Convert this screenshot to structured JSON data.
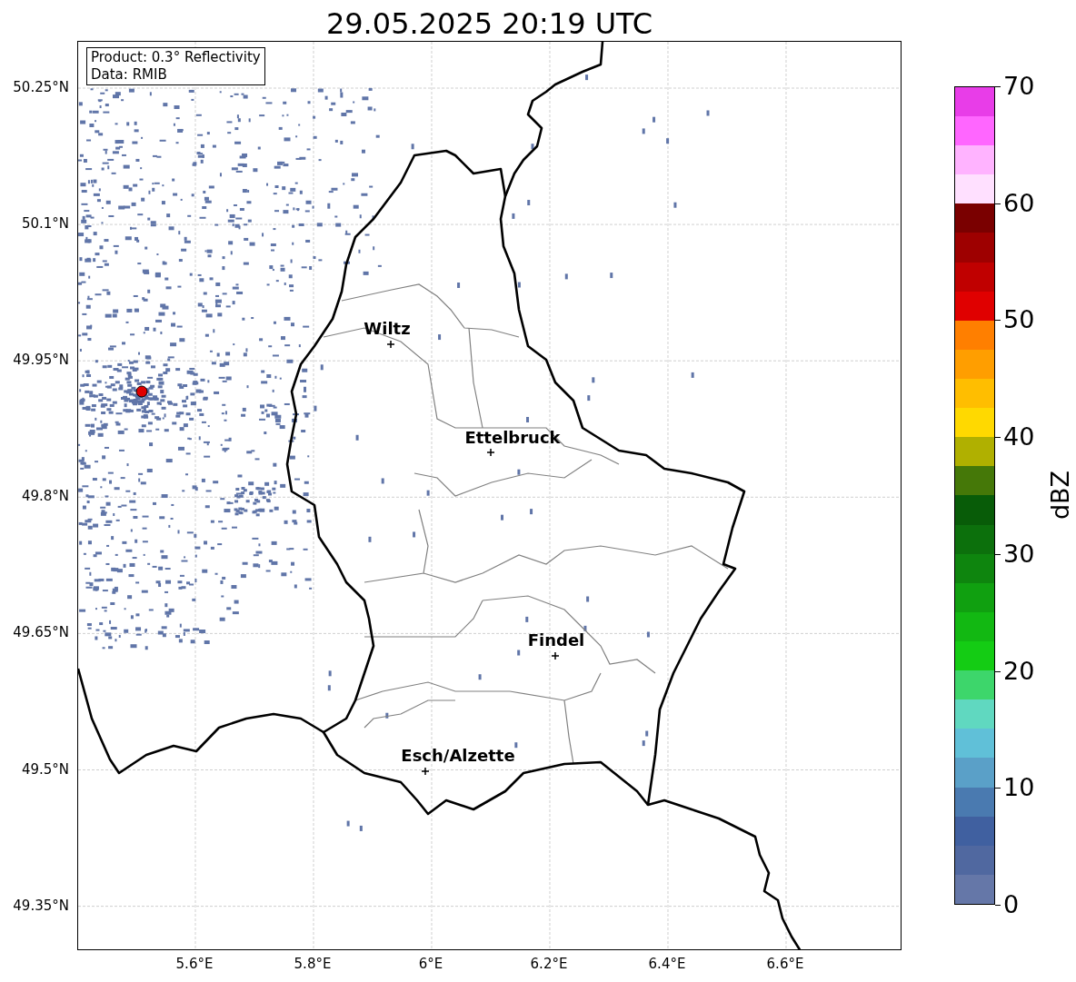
{
  "title": "29.05.2025 20:19 UTC",
  "info_box": {
    "lines": [
      "Product: 0.3° Reflectivity",
      "Data: RMIB"
    ]
  },
  "map": {
    "y_ticks": [
      "50.25°N",
      "50.1°N",
      "49.95°N",
      "49.8°N",
      "49.65°N",
      "49.5°N",
      "49.35°N"
    ],
    "x_ticks": [
      "5.6°E",
      "5.8°E",
      "6°E",
      "6.2°E",
      "6.4°E",
      "6.6°E"
    ],
    "cities": [
      {
        "name": "Wiltz"
      },
      {
        "name": "Ettelbruck"
      },
      {
        "name": "Findel"
      },
      {
        "name": "Esch/Alzette"
      }
    ]
  },
  "colorbar": {
    "label": "dBZ",
    "ticks": [
      "70",
      "60",
      "50",
      "40",
      "30",
      "20",
      "10",
      "0"
    ],
    "segments": [
      {
        "color": "#6577a8"
      },
      {
        "color": "#5068a0"
      },
      {
        "color": "#4060a0"
      },
      {
        "color": "#4a7ab0"
      },
      {
        "color": "#5aa0c8"
      },
      {
        "color": "#60c0d8"
      },
      {
        "color": "#60d8c0"
      },
      {
        "color": "#3dd66b"
      },
      {
        "color": "#14cc14"
      },
      {
        "color": "#12b812"
      },
      {
        "color": "#10a010"
      },
      {
        "color": "#0e850e"
      },
      {
        "color": "#0c700c"
      },
      {
        "color": "#085c08"
      },
      {
        "color": "#457808"
      },
      {
        "color": "#b0b000"
      },
      {
        "color": "#ffd900"
      },
      {
        "color": "#ffbe00"
      },
      {
        "color": "#ff9e00"
      },
      {
        "color": "#ff7f00"
      },
      {
        "color": "#e00000"
      },
      {
        "color": "#c00000"
      },
      {
        "color": "#9e0000"
      },
      {
        "color": "#7a0000"
      },
      {
        "color": "#ffe0ff"
      },
      {
        "color": "#ffb3ff"
      },
      {
        "color": "#ff66ff"
      },
      {
        "color": "#e83de8"
      }
    ]
  }
}
